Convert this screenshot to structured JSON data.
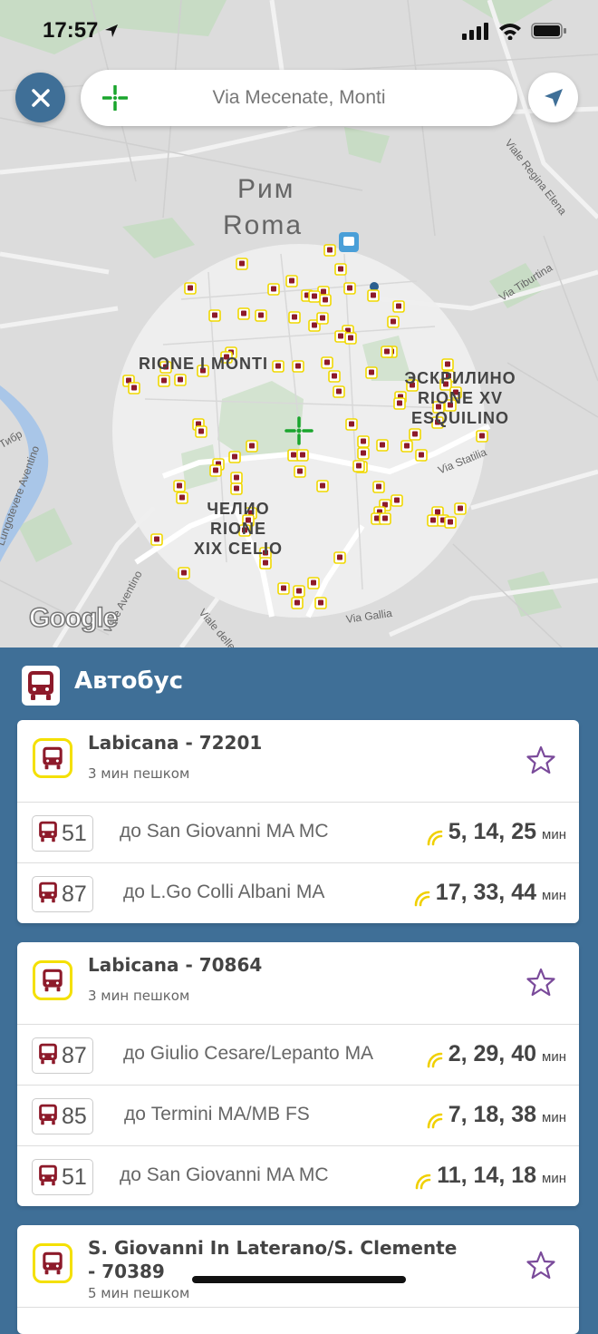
{
  "status_bar": {
    "time": "17:57"
  },
  "search": {
    "value": "Via Mecenate, Monti"
  },
  "map": {
    "city_ru": "Рим",
    "city_it": "Roma",
    "districts": [
      {
        "id": "monti",
        "lines": [
          "RIONE I MONTI"
        ]
      },
      {
        "id": "esquilino",
        "lines": [
          "ЭСКРИЛИНО",
          "RIONE XV",
          "ESQUILINO"
        ]
      },
      {
        "id": "celio",
        "lines": [
          "ЧЕЛИО",
          "RIONE",
          "XIX CELIO"
        ]
      }
    ],
    "streets": [
      "Viale Regina Elena",
      "Via Tiburtina",
      "Via Statilia",
      "Via Gallia",
      "Viale delle Terme",
      "Viale Aventino",
      "Lungotevere Aventino",
      "Тибр"
    ],
    "attribution": "Google",
    "accent_color": "#1aa52d"
  },
  "panel": {
    "title": "Автобус",
    "colors": {
      "panel": "#3f6f97",
      "bus": "#8d1a2a",
      "stop_border": "#f4e000",
      "star": "#7a4a9a"
    },
    "stops": [
      {
        "name": "Labicana - 72201",
        "walk": "3 мин пешком",
        "lines": [
          {
            "num": "51",
            "dest": "до San Giovanni  MA MC",
            "times": "5, 14, 25",
            "unit": "мин"
          },
          {
            "num": "87",
            "dest": "до L.Go Colli Albani  MA",
            "times": "17, 33, 44",
            "unit": "мин"
          }
        ]
      },
      {
        "name": "Labicana - 70864",
        "walk": "3 мин пешком",
        "lines": [
          {
            "num": "87",
            "dest": "до Giulio Cesare/Lepanto  MA",
            "times": "2, 29, 40",
            "unit": "мин"
          },
          {
            "num": "85",
            "dest": "до Termini  MA/MB FS",
            "times": "7, 18, 38",
            "unit": "мин"
          },
          {
            "num": "51",
            "dest": "до San Giovanni  MA MC",
            "times": "11, 14, 18",
            "unit": "мин"
          }
        ]
      },
      {
        "name": "S. Giovanni In Laterano/S. Clemente - 70389",
        "walk": "5 мин пешком",
        "lines": []
      }
    ]
  }
}
